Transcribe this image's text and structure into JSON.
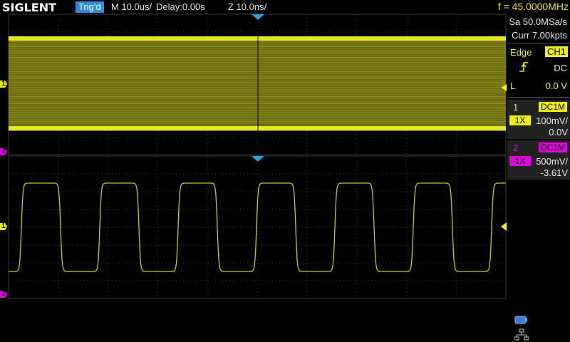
{
  "header": {
    "brand": "SIGLENT",
    "trig_status": "Trig'd",
    "main_timebase": "M 10.0us/",
    "delay": "Delay:0.00s",
    "zoom_timebase": "Z 10.0ns/",
    "frequency": "f = 45.0000MHz"
  },
  "acquisition": {
    "sample_rate": "Sa 50.0MSa/s",
    "memory_depth": "Curr 7.00kpts"
  },
  "trigger": {
    "type": "Edge",
    "source": "CH1",
    "slope_icon": "rising-edge-icon",
    "coupling": "DC",
    "level_label": "L",
    "level": "0.0 V"
  },
  "channels": [
    {
      "number": "1",
      "coupling": "DC1M",
      "probe": "1X",
      "scale": "100mV/",
      "offset": "0.0V",
      "color": "#f0f000"
    },
    {
      "number": "2",
      "coupling": "DC1M",
      "probe": "1X",
      "scale": "500mV/",
      "offset": "-3.61V",
      "color": "#e000e0"
    }
  ],
  "markers": {
    "ch1": "1",
    "ch2": "2"
  },
  "icons": {
    "battery": "battery-icon",
    "network": "network-icon"
  }
}
